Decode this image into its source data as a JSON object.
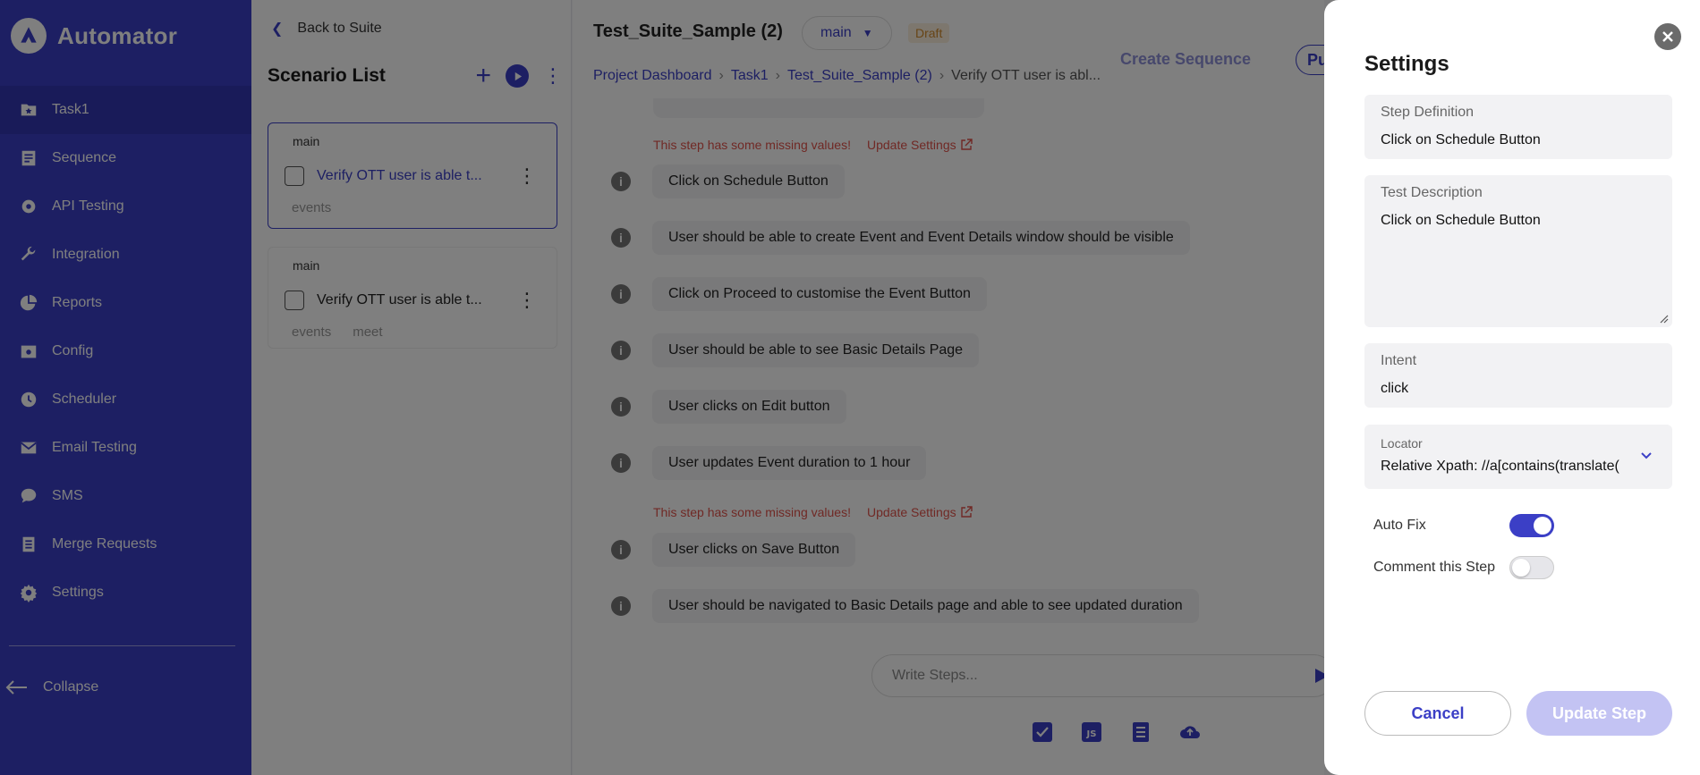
{
  "sidebar": {
    "app_name": "Automator",
    "items": [
      {
        "label": "Task1",
        "icon": "folder-star-icon",
        "active": true
      },
      {
        "label": "Sequence",
        "icon": "sequence-icon"
      },
      {
        "label": "API Testing",
        "icon": "api-testing-icon"
      },
      {
        "label": "Integration",
        "icon": "wrench-icon"
      },
      {
        "label": "Reports",
        "icon": "pie-chart-icon"
      },
      {
        "label": "Config",
        "icon": "config-icon"
      },
      {
        "label": "Scheduler",
        "icon": "clock-icon"
      },
      {
        "label": "Email Testing",
        "icon": "mail-icon"
      },
      {
        "label": "SMS",
        "icon": "chat-bubble-icon"
      },
      {
        "label": "Merge Requests",
        "icon": "merge-icon"
      },
      {
        "label": "Settings",
        "icon": "gear-icon"
      }
    ],
    "collapse_label": "Collapse"
  },
  "scenario_panel": {
    "back_label": "Back to Suite",
    "title": "Scenario List",
    "cards": [
      {
        "branch": "main",
        "name": "Verify OTT user is able t...",
        "tags": [
          "events"
        ]
      },
      {
        "branch": "main",
        "name": "Verify OTT user is able t...",
        "tags": [
          "events",
          "meet"
        ]
      }
    ]
  },
  "main": {
    "suite_title": "Test_Suite_Sample (2)",
    "branch": "main",
    "status_badge": "Draft",
    "create_sequence_label": "Create Sequence",
    "pu_label": "Pu",
    "breadcrumbs": [
      "Project Dashboard",
      "Task1",
      "Test_Suite_Sample (2)",
      "Verify OTT user is abl..."
    ],
    "warning_text": "This step has some missing values!",
    "update_settings_label": "Update Settings",
    "steps": [
      "Click on Schedule Button",
      "User should be able to create Event and Event Details window should be visible",
      "Click on Proceed to customise the Event Button",
      "User should be able to see Basic Details Page",
      "User clicks on Edit button",
      "User updates Event duration to 1 hour",
      "User clicks on Save Button",
      "User should be navigated to Basic Details page and able to see updated duration"
    ],
    "write_placeholder": "Write Steps..."
  },
  "settings": {
    "title": "Settings",
    "step_definition_label": "Step Definition",
    "step_definition_value": "Click on Schedule Button",
    "test_description_label": "Test Description",
    "test_description_value": "Click on Schedule Button",
    "intent_label": "Intent",
    "intent_value": "click",
    "locator_label": "Locator",
    "locator_value": "Relative Xpath: //a[contains(translate(",
    "auto_fix_label": "Auto Fix",
    "auto_fix_on": true,
    "comment_label": "Comment this Step",
    "comment_on": false,
    "cancel_label": "Cancel",
    "update_label": "Update Step"
  },
  "colors": {
    "accent": "#3b3fc6",
    "warning": "#e0524a",
    "draft": "#d08a2c"
  }
}
